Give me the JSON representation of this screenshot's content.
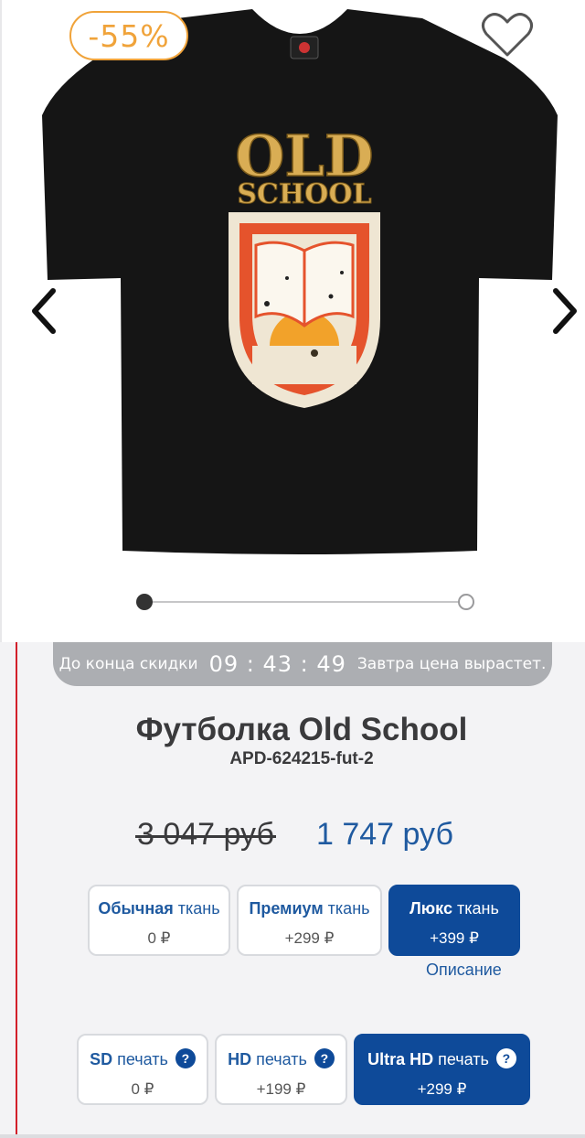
{
  "gallery": {
    "discount_badge": "-55%",
    "shirt_print_line1": "OLD",
    "shirt_print_line2": "SCHOOL",
    "slide_progress": 0.0
  },
  "timer": {
    "label": "До конца скидки",
    "clock": "09 : 43 : 49",
    "note": "Завтра цена вырастет."
  },
  "product": {
    "title": "Футболка Old School",
    "sku": "APD-624215-fut-2"
  },
  "price": {
    "old": "3 047 руб",
    "new": "1 747 руб"
  },
  "fabric": {
    "options": [
      {
        "name": "Обычная",
        "suffix": "ткань",
        "price": "0 ₽",
        "selected": false
      },
      {
        "name": "Премиум",
        "suffix": "ткань",
        "price": "+299 ₽",
        "selected": false
      },
      {
        "name": "Люкс",
        "suffix": "ткань",
        "price": "+399 ₽",
        "selected": true
      }
    ],
    "description_link": "Описание"
  },
  "print": {
    "options": [
      {
        "name": "SD",
        "suffix": "печать",
        "help": "?",
        "price": "0 ₽",
        "selected": false
      },
      {
        "name": "HD",
        "suffix": "печать",
        "help": "?",
        "price": "+199 ₽",
        "selected": false
      },
      {
        "name": "Ultra HD",
        "suffix": "печать",
        "help": "?",
        "price": "+299 ₽",
        "selected": true
      }
    ]
  },
  "colors": {
    "accent_blue": "#0e4a99",
    "price_blue": "#1f5aa0",
    "badge_orange": "#f0a33a",
    "left_rule_red": "#d21f2a"
  }
}
